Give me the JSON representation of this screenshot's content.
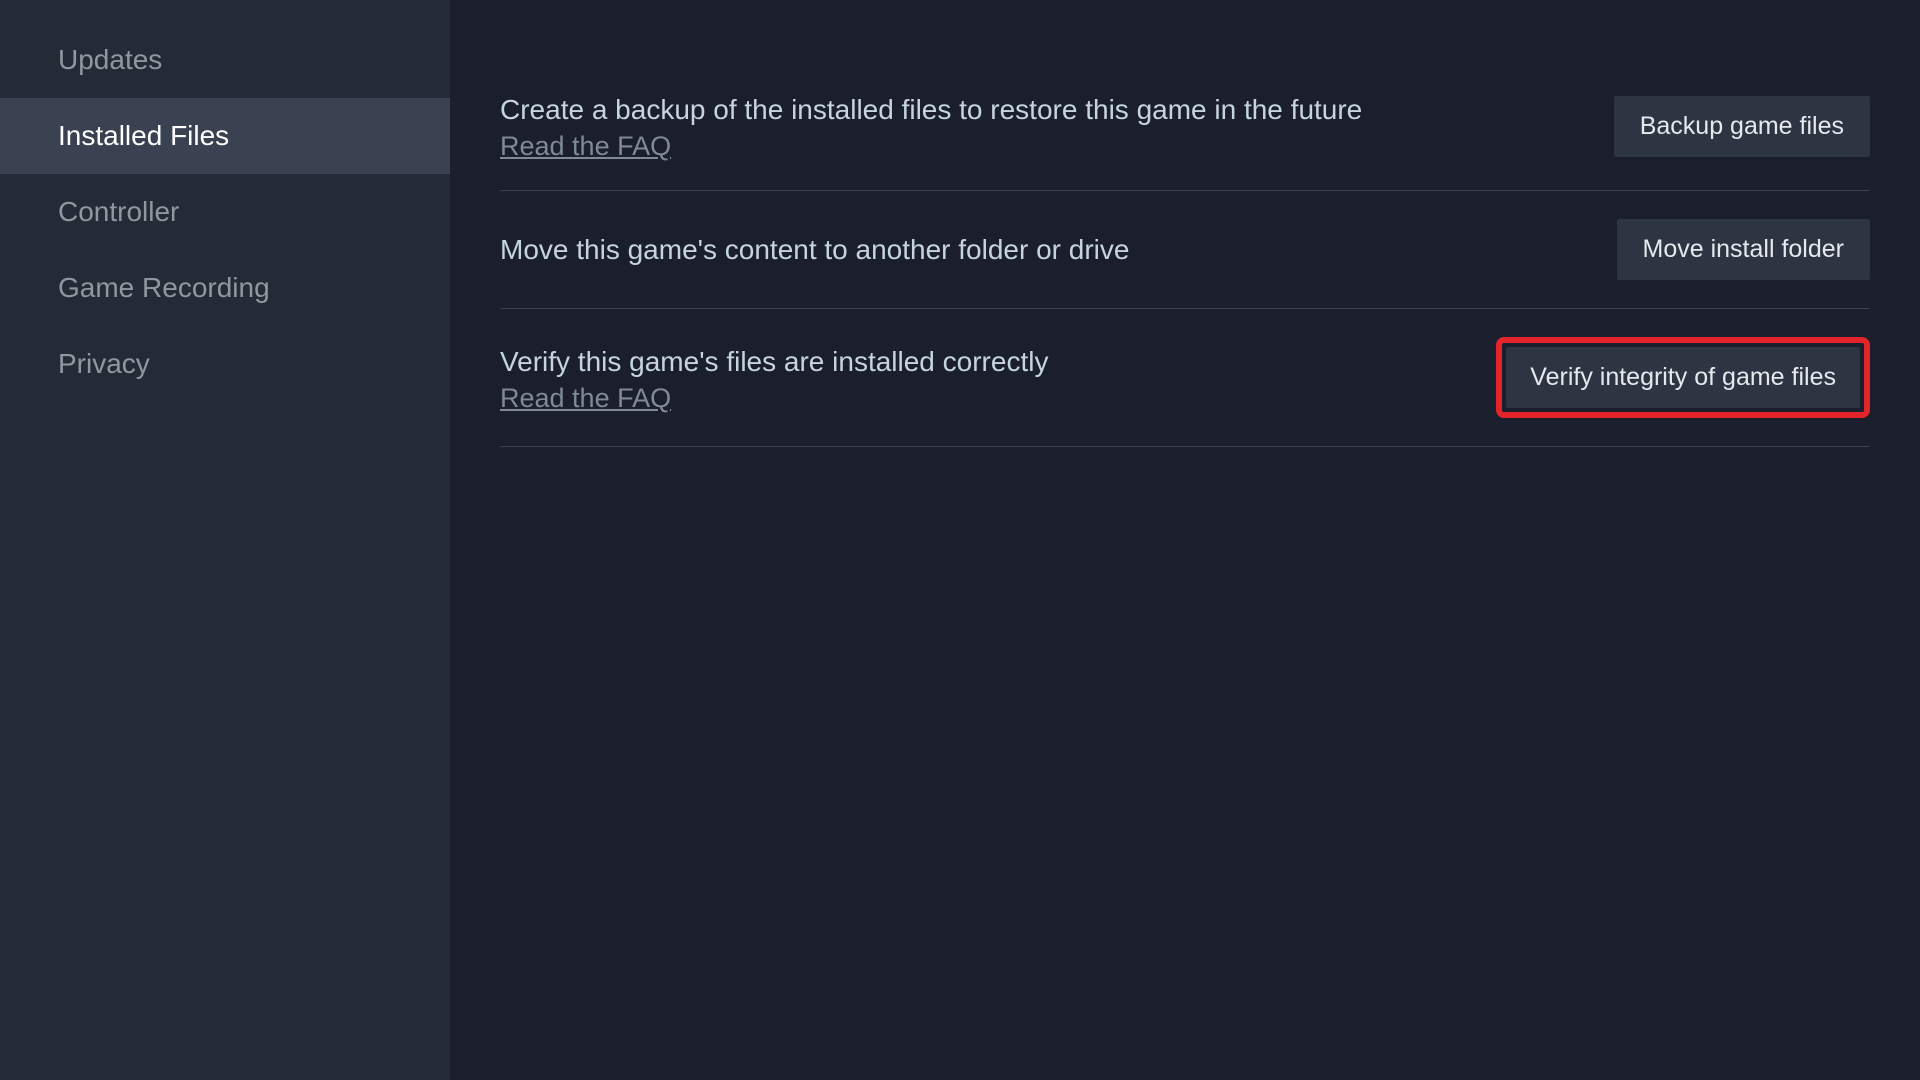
{
  "sidebar": {
    "items": [
      {
        "label": "Updates",
        "active": false
      },
      {
        "label": "Installed Files",
        "active": true
      },
      {
        "label": "Controller",
        "active": false
      },
      {
        "label": "Game Recording",
        "active": false
      },
      {
        "label": "Privacy",
        "active": false
      }
    ]
  },
  "main": {
    "rows": [
      {
        "description": "Create a backup of the installed files to restore this game in the future",
        "link": "Read the FAQ",
        "button": "Backup game files"
      },
      {
        "description": "Move this game's content to another folder or drive",
        "link": null,
        "button": "Move install folder"
      },
      {
        "description": "Verify this game's files are installed correctly",
        "link": "Read the FAQ",
        "button": "Verify integrity of game files",
        "highlighted": true
      }
    ]
  }
}
